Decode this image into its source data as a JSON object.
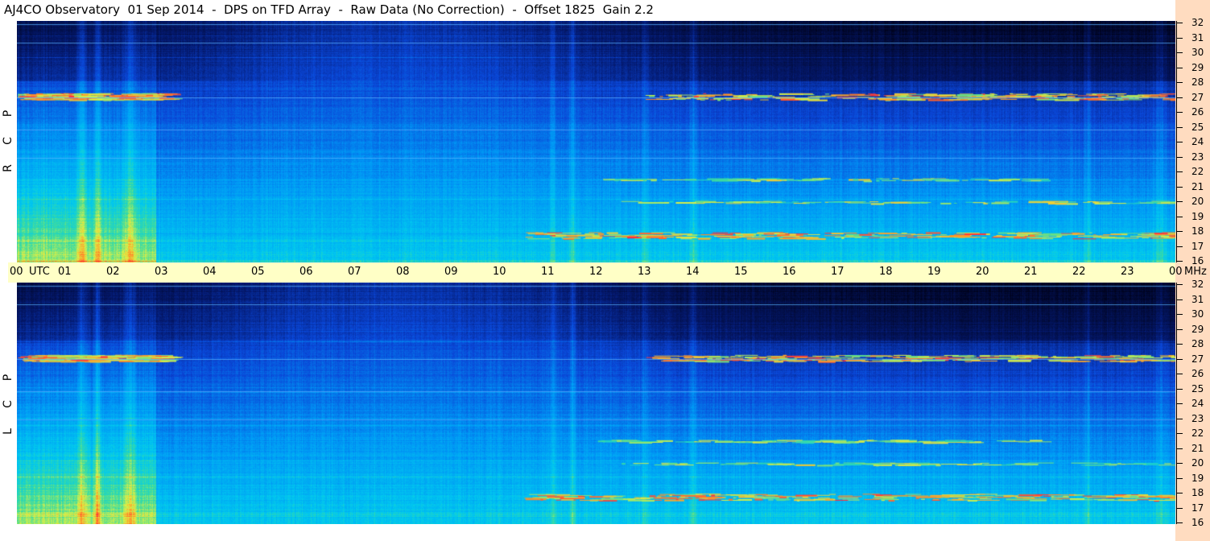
{
  "title": "AJ4CO Observatory  01 Sep 2014  -  DPS on TFD Array  -  Raw Data (No Correction)  -  Offset 1825  Gain 2.2",
  "panels": [
    {
      "letters": [
        "P",
        "C",
        "R"
      ]
    },
    {
      "letters": [
        "P",
        "C",
        "L"
      ]
    }
  ],
  "time_axis": {
    "ticks": [
      "00",
      "01",
      "02",
      "03",
      "04",
      "05",
      "06",
      "07",
      "08",
      "09",
      "10",
      "11",
      "12",
      "13",
      "14",
      "15",
      "16",
      "17",
      "18",
      "19",
      "20",
      "21",
      "22",
      "23",
      "00"
    ],
    "utc_label": "UTC",
    "unit": "MHz"
  },
  "freq_axis": {
    "ticks": [
      "32",
      "31",
      "30",
      "29",
      "28",
      "27",
      "26",
      "25",
      "24",
      "23",
      "22",
      "21",
      "20",
      "19",
      "18",
      "17",
      "16"
    ]
  },
  "colors": {
    "background_high": "#000a2e",
    "mid": "#0a4fd8",
    "low": "#00b4ff",
    "hot_yellow": "#e8f040",
    "hot_red": "#ff3030",
    "time_bar": "#ffffc6",
    "freq_bar": "#ffdcc0"
  },
  "chart_data": [
    {
      "type": "heatmap",
      "title": "AJ4CO Observatory  01 Sep 2014  -  DPS on TFD Array  -  Raw Data (No Correction)  -  Offset 1825  Gain 2.2",
      "xlabel": "UTC",
      "ylabel": "MHz",
      "x_range": [
        0,
        24
      ],
      "y_range": [
        16,
        32
      ],
      "polarization": "RCP",
      "features": [
        {
          "freq": 27,
          "start": 0.0,
          "end": 3.0,
          "intensity": "high"
        },
        {
          "freq": 27,
          "start": 13.0,
          "end": 24.0,
          "intensity": "high"
        },
        {
          "freq": 17.8,
          "start": 10.5,
          "end": 24.0,
          "intensity": "high"
        },
        {
          "freq": 20,
          "start": 12.5,
          "end": 24.0,
          "intensity": "medium"
        },
        {
          "freq": 21.5,
          "start": 12.0,
          "end": 21.0,
          "intensity": "medium"
        }
      ]
    },
    {
      "type": "heatmap",
      "xlabel": "UTC",
      "ylabel": "MHz",
      "x_range": [
        0,
        24
      ],
      "y_range": [
        16,
        32
      ],
      "polarization": "LCP",
      "features": [
        {
          "freq": 27,
          "start": 0.0,
          "end": 3.0,
          "intensity": "high"
        },
        {
          "freq": 27,
          "start": 13.0,
          "end": 24.0,
          "intensity": "high"
        },
        {
          "freq": 17.8,
          "start": 10.5,
          "end": 24.0,
          "intensity": "high"
        },
        {
          "freq": 20,
          "start": 12.5,
          "end": 24.0,
          "intensity": "medium"
        },
        {
          "freq": 21.5,
          "start": 12.0,
          "end": 21.0,
          "intensity": "medium"
        }
      ]
    }
  ]
}
